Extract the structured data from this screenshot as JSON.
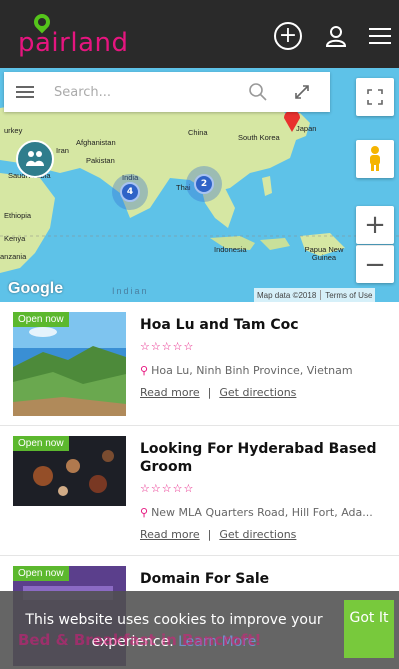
{
  "app": {
    "logo_text": "pairland"
  },
  "header": {
    "add_icon": "plus-circle-icon",
    "user_icon": "user-icon",
    "menu_icon": "hamburger-icon"
  },
  "map": {
    "search_placeholder": "Search...",
    "labels": {
      "turkey": "urkey",
      "afghanistan": "Afghanistan",
      "iran": "Iran",
      "pakistan": "Pakistan",
      "china": "China",
      "south_korea": "South Korea",
      "japan": "Japan",
      "saudi_arabia": "Saudi Arabia",
      "india": "India",
      "thailand": "Thai",
      "ethiopia": "Ethiopia",
      "kenya": "Kenya",
      "tanzania": "anzania",
      "indonesia": "Indonesia",
      "papua_new_guinea": "Papua New Guinea",
      "indian_ocean": "Indian"
    },
    "clusters": [
      {
        "name": "india-cluster",
        "count": "4"
      },
      {
        "name": "thailand-cluster",
        "count": "2"
      }
    ],
    "google_logo": "Google",
    "map_data": "Map data ©2018",
    "terms": "Terms of Use",
    "zoom_in": "+",
    "zoom_out": "−"
  },
  "listings": [
    {
      "badge": "Open now",
      "title": "Hoa Lu and Tam Coc",
      "rating_stars": "☆☆☆☆☆",
      "address": "Hoa Lu, Ninh Binh Province, Vietnam",
      "read_more": "Read more",
      "directions": "Get directions"
    },
    {
      "badge": "Open now",
      "title": "Looking For Hyderabad Based Groom",
      "rating_stars": "☆☆☆☆☆",
      "address": "New MLA Quarters Road, Hill Fort, Ada...",
      "read_more": "Read more",
      "directions": "Get directions"
    },
    {
      "badge": "Open now",
      "title": "Domain For Sale"
    }
  ],
  "cookie": {
    "message": "This website uses cookies to improve your experience.",
    "learn_more": "Learn More",
    "got_it": "Got It",
    "background_text": "Bed & Breakfast in Bancroft!"
  },
  "colors": {
    "brand": "#e6157f",
    "header_bg": "#2a2a2a",
    "open_badge": "#5cb82e",
    "ocean": "#5ec2e8",
    "land": "#d6e7a3"
  }
}
